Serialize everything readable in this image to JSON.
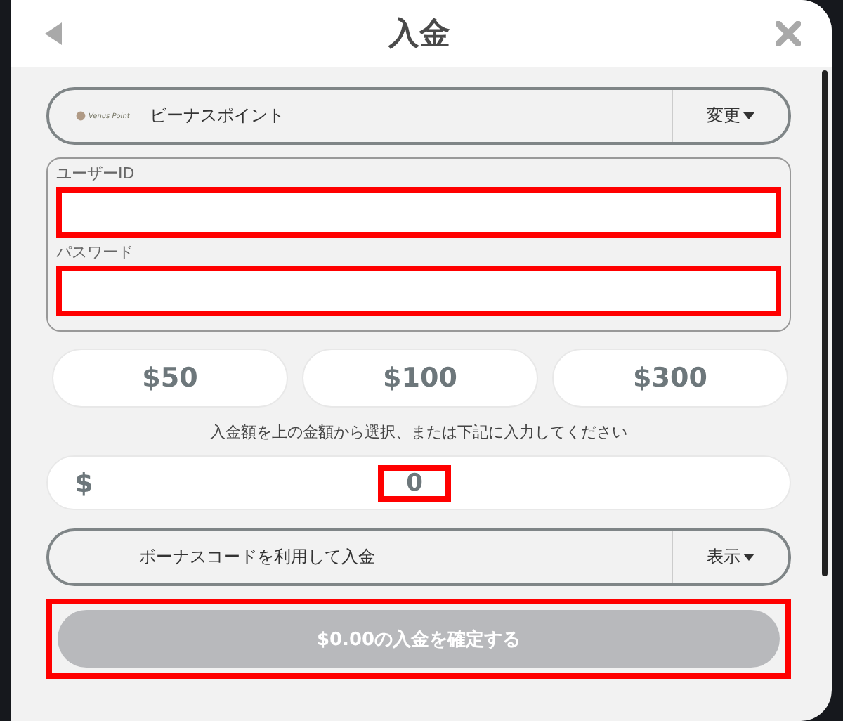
{
  "dialog": {
    "title": "入金"
  },
  "payment_method": {
    "logo_text": "Venus Point",
    "name": "ビーナスポイント",
    "change_label": "変更"
  },
  "credentials": [
    {
      "label": "ユーザーID",
      "highlighted": true
    },
    {
      "label": "パスワード",
      "highlighted": true
    }
  ],
  "amount_options": [
    {
      "label": "$50",
      "selected": false
    },
    {
      "label": "$100",
      "selected": false
    },
    {
      "label": "$300",
      "selected": false
    }
  ],
  "amount_hint": "入金額を上の金額から選択、または下記に入力してください",
  "amount_field": {
    "currency": "$",
    "value": "0",
    "highlighted": true
  },
  "bonus": {
    "label": "ボーナスコードを利用して入金",
    "toggle_label": "表示"
  },
  "confirm_button": {
    "label": "$0.00の入金を確定する",
    "disabled": true,
    "highlighted": true
  }
}
